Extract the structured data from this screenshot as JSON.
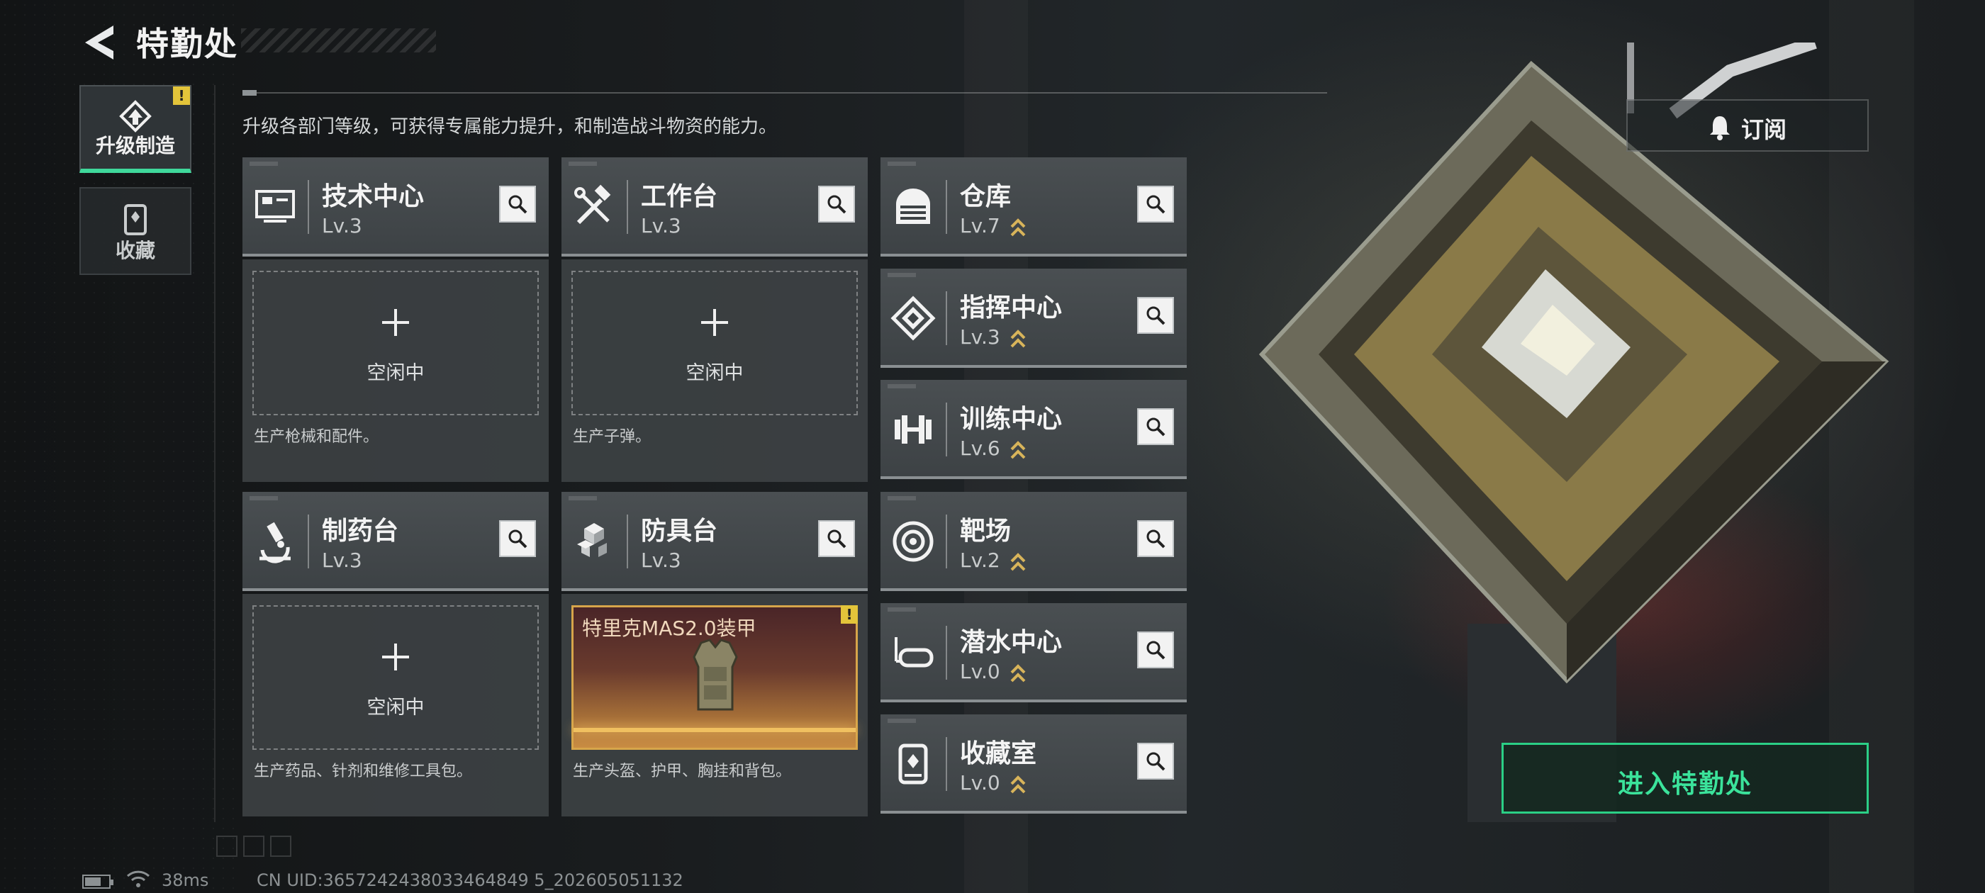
{
  "header": {
    "title": "特勤处"
  },
  "nav": {
    "tabs": [
      {
        "label": "升级制造",
        "active": true,
        "has_alert": true,
        "alert_mark": "!"
      },
      {
        "label": "收藏",
        "active": false
      }
    ]
  },
  "intro_text": "升级各部门等级，可获得专属能力提升，和制造战斗物资的能力。",
  "subscribe": {
    "label": "订阅",
    "icon": "bell-gear-icon"
  },
  "facilities_large": [
    {
      "name": "技术中心",
      "level": "Lv.3",
      "icon": "tech-center-icon",
      "slot_state": "空闲中",
      "description": "生产枪械和配件。"
    },
    {
      "name": "工作台",
      "level": "Lv.3",
      "icon": "tools-icon",
      "slot_state": "空闲中",
      "description": "生产子弹。"
    },
    {
      "name": "制药台",
      "level": "Lv.3",
      "icon": "microscope-icon",
      "slot_state": "空闲中",
      "description": "生产药品、针剂和维修工具包。"
    },
    {
      "name": "防具台",
      "level": "Lv.3",
      "icon": "armor-blocks-icon",
      "product": "特里克MAS2.0装甲",
      "product_alert": "!",
      "description": "生产头盔、护甲、胸挂和背包。"
    }
  ],
  "facilities_small": [
    {
      "name": "仓库",
      "level": "Lv.7",
      "upgradable": true,
      "icon": "warehouse-icon"
    },
    {
      "name": "指挥中心",
      "level": "Lv.3",
      "upgradable": true,
      "icon": "command-center-icon"
    },
    {
      "name": "训练中心",
      "level": "Lv.6",
      "upgradable": true,
      "icon": "dumbbell-icon"
    },
    {
      "name": "靶场",
      "level": "Lv.2",
      "upgradable": true,
      "icon": "target-icon"
    },
    {
      "name": "潜水中心",
      "level": "Lv.0",
      "upgradable": true,
      "icon": "diving-mask-icon"
    },
    {
      "name": "收藏室",
      "level": "Lv.0",
      "upgradable": true,
      "icon": "collection-room-icon"
    }
  ],
  "enter_button": {
    "label": "进入特勤处"
  },
  "status_bar": {
    "ping": "38ms",
    "uid": "CN UID:3657242438033464849 5_202605051132"
  },
  "colors": {
    "accent_green": "#3be39b",
    "alert_yellow": "#e3c43a",
    "upgrade_gold": "#d8b45a"
  }
}
